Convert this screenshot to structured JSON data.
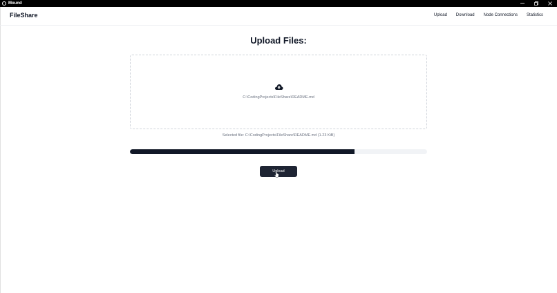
{
  "window": {
    "title": "Mound",
    "controls": {
      "minimize_icon": "minimize-icon",
      "restore_icon": "restore-icon",
      "close_icon": "close-icon"
    }
  },
  "header": {
    "brand": "FileShare",
    "nav": [
      "Upload",
      "Download",
      "Node Connections",
      "Statistics"
    ]
  },
  "main": {
    "title": "Upload Files:",
    "drop_zone": {
      "icon": "cloud-upload-icon",
      "path": "C:\\CodingProjects\\FileShare\\README.md"
    },
    "selected_file": "Selected file: C:\\CodingProjects\\FileShare\\README.md (1.23 KiB)",
    "progress": 0.755,
    "upload_button": "Upload"
  },
  "colors": {
    "accent": "#111827",
    "button": "#1e2433",
    "track": "#f1f3f6",
    "muted_text": "#6b7280"
  }
}
